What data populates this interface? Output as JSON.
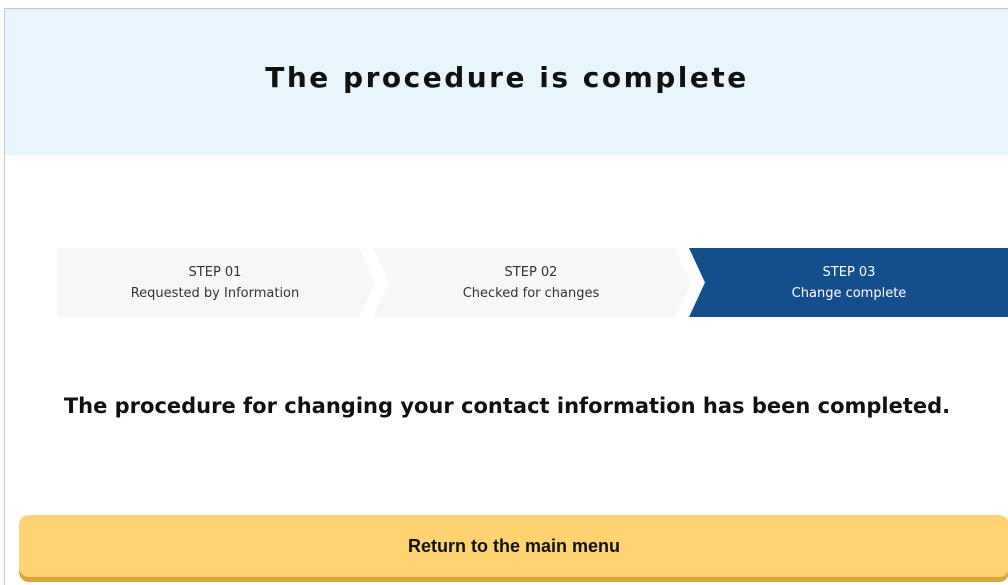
{
  "hero": {
    "title": "The procedure is complete"
  },
  "steps": [
    {
      "number": "STEP 01",
      "label": "Requested by Information",
      "active": false
    },
    {
      "number": "STEP 02",
      "label": "Checked for changes",
      "active": false
    },
    {
      "number": "STEP 03",
      "label": "Change complete",
      "active": true
    }
  ],
  "message": {
    "text": "The procedure for changing your contact information has been completed."
  },
  "actions": {
    "return_label": "Return to the main menu"
  },
  "colors": {
    "hero_background": "#e8f5fd",
    "step_inactive": "#f7f7f7",
    "step_active": "#154e8d",
    "button_background": "#ffd272",
    "button_shadow": "#dca540"
  }
}
